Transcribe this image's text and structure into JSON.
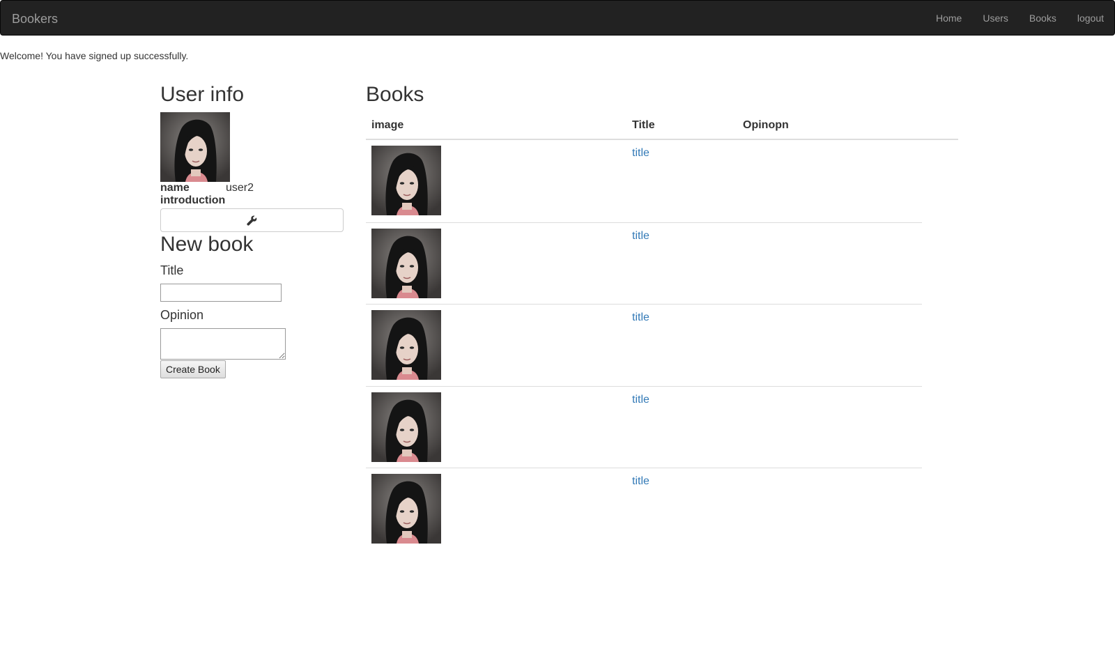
{
  "navbar": {
    "brand": "Bookers",
    "links": [
      "Home",
      "Users",
      "Books",
      "logout"
    ]
  },
  "flash": "Welcome! You have signed up successfully.",
  "user_info": {
    "heading": "User info",
    "avatar_icon": "user-avatar-photo",
    "name_label": "name",
    "name_value": "user2",
    "introduction_label": "introduction",
    "introduction_value": "",
    "edit_icon": "wrench-icon"
  },
  "new_book": {
    "heading": "New book",
    "title_label": "Title",
    "title_value": "",
    "opinion_label": "Opinion",
    "opinion_value": "",
    "submit_label": "Create Book"
  },
  "books": {
    "heading": "Books",
    "columns": [
      "image",
      "Title",
      "Opinopn"
    ],
    "rows": [
      {
        "title": "title",
        "opinion": ""
      },
      {
        "title": "title",
        "opinion": ""
      },
      {
        "title": "title",
        "opinion": ""
      },
      {
        "title": "title",
        "opinion": ""
      },
      {
        "title": "title",
        "opinion": ""
      }
    ]
  },
  "colors": {
    "navbar_bg": "#222222",
    "nav_text": "#9d9d9d",
    "link": "#337ab7"
  }
}
